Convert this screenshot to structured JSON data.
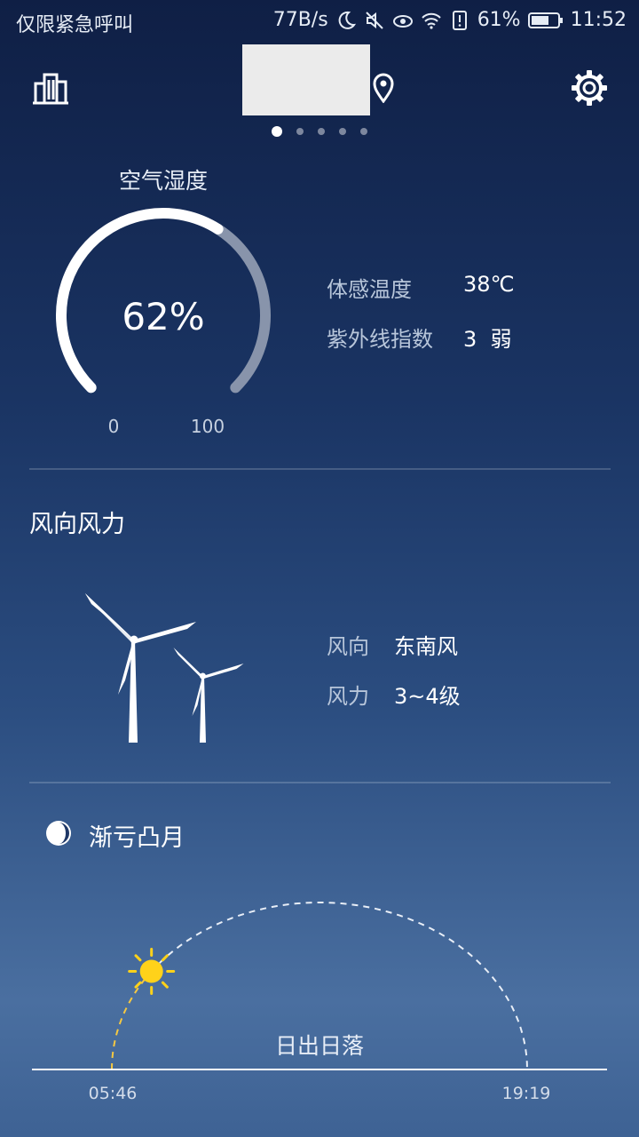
{
  "status_bar": {
    "carrier": "仅限紧急呼叫",
    "net_speed": "77B/s",
    "battery": "61%",
    "time": "11:52"
  },
  "header": {
    "icons": [
      "city-icon",
      "location-pin-icon",
      "settings-gear-icon"
    ],
    "page_count": 5,
    "active_page": 1
  },
  "humidity": {
    "title": "空气湿度",
    "value": "62%",
    "percent": 62,
    "min_label": "0",
    "max_label": "100"
  },
  "details": {
    "feels_like_label": "体感温度",
    "feels_like_value": "38℃",
    "uv_label": "紫外线指数",
    "uv_value": "3  弱"
  },
  "wind": {
    "section_title": "风向风力",
    "direction_label": "风向",
    "direction_value": "东南风",
    "force_label": "风力",
    "force_value": "3~4级"
  },
  "moon": {
    "phase": "渐亏凸月",
    "icon": "moon-phase-icon"
  },
  "sun": {
    "title": "日出日落",
    "sunrise": "05:46",
    "sunset": "19:19",
    "progress": 0.2,
    "icon": "sun-icon"
  },
  "colors": {
    "gauge_fill": "#ffffff",
    "gauge_track": "#8894ab",
    "sun": "#ffd21a",
    "sun_path_done": "#f5c842"
  }
}
